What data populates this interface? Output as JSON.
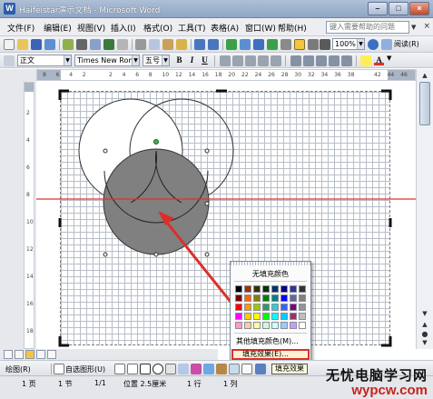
{
  "window": {
    "title": "Haifeistar演示文档 - Microsoft Word",
    "icon": "word-icon",
    "buttons": [
      "minimize-icon",
      "maximize-icon",
      "close-icon"
    ]
  },
  "menubar": {
    "items": [
      "文件(F)",
      "编辑(E)",
      "视图(V)",
      "插入(I)",
      "格式(O)",
      "工具(T)",
      "表格(A)",
      "窗口(W)",
      "帮助(H)"
    ],
    "help_placeholder": "键入需要帮助的问题",
    "close_glyph": "×"
  },
  "standard_toolbar": {
    "zoom": "100%",
    "reading_mode": "阅读(R)"
  },
  "format_toolbar": {
    "style": "正文",
    "font": "Times New Roman",
    "size": "五号",
    "bold": "B",
    "italic": "I",
    "underline": "U",
    "font_color_glyph": "A"
  },
  "ruler_labels": [
    "8",
    "6",
    "4",
    "2",
    "",
    "2",
    "4",
    "6",
    "8",
    "10",
    "12",
    "14",
    "16",
    "18",
    "20",
    "22",
    "24",
    "26",
    "28",
    "30",
    "32",
    "34",
    "36",
    "38",
    "",
    "42",
    "44",
    "46"
  ],
  "fill_popup": {
    "no_fill": "无填充颜色",
    "more_colors": "其他填充颜色(M)...",
    "fill_effects": "填充效果(E)...",
    "swatch_colors": [
      [
        "#000000",
        "#993300",
        "#333300",
        "#003300",
        "#003366",
        "#000080",
        "#333399",
        "#333333"
      ],
      [
        "#800000",
        "#ff6600",
        "#808000",
        "#008000",
        "#008080",
        "#0000ff",
        "#666699",
        "#808080"
      ],
      [
        "#ff0000",
        "#ff9900",
        "#99cc00",
        "#339966",
        "#33cccc",
        "#3366ff",
        "#800080",
        "#969696"
      ],
      [
        "#ff00ff",
        "#ffcc00",
        "#ffff00",
        "#00ff00",
        "#00ffff",
        "#00ccff",
        "#993366",
        "#c0c0c0"
      ],
      [
        "#ff99cc",
        "#ffcc99",
        "#ffff99",
        "#ccffcc",
        "#ccffff",
        "#99ccff",
        "#cc99ff",
        "#ffffff"
      ]
    ]
  },
  "tooltip": "填充效果",
  "drawing_toolbar": {
    "draw_menu": "绘图(R)",
    "autoshapes": "自选图形(U)"
  },
  "statusbar": {
    "page": "1 页",
    "section": "1 节",
    "page_of": "1/1",
    "position": "位置 2.5厘米",
    "line": "1 行",
    "column": "1 列"
  },
  "watermark": {
    "cn": "无忧电脑学习网",
    "url": "wypcw.com"
  },
  "accent_colors": {
    "arrow": "#d9312a",
    "guide_line": "#e0302c",
    "filled_circle": "#808080"
  }
}
